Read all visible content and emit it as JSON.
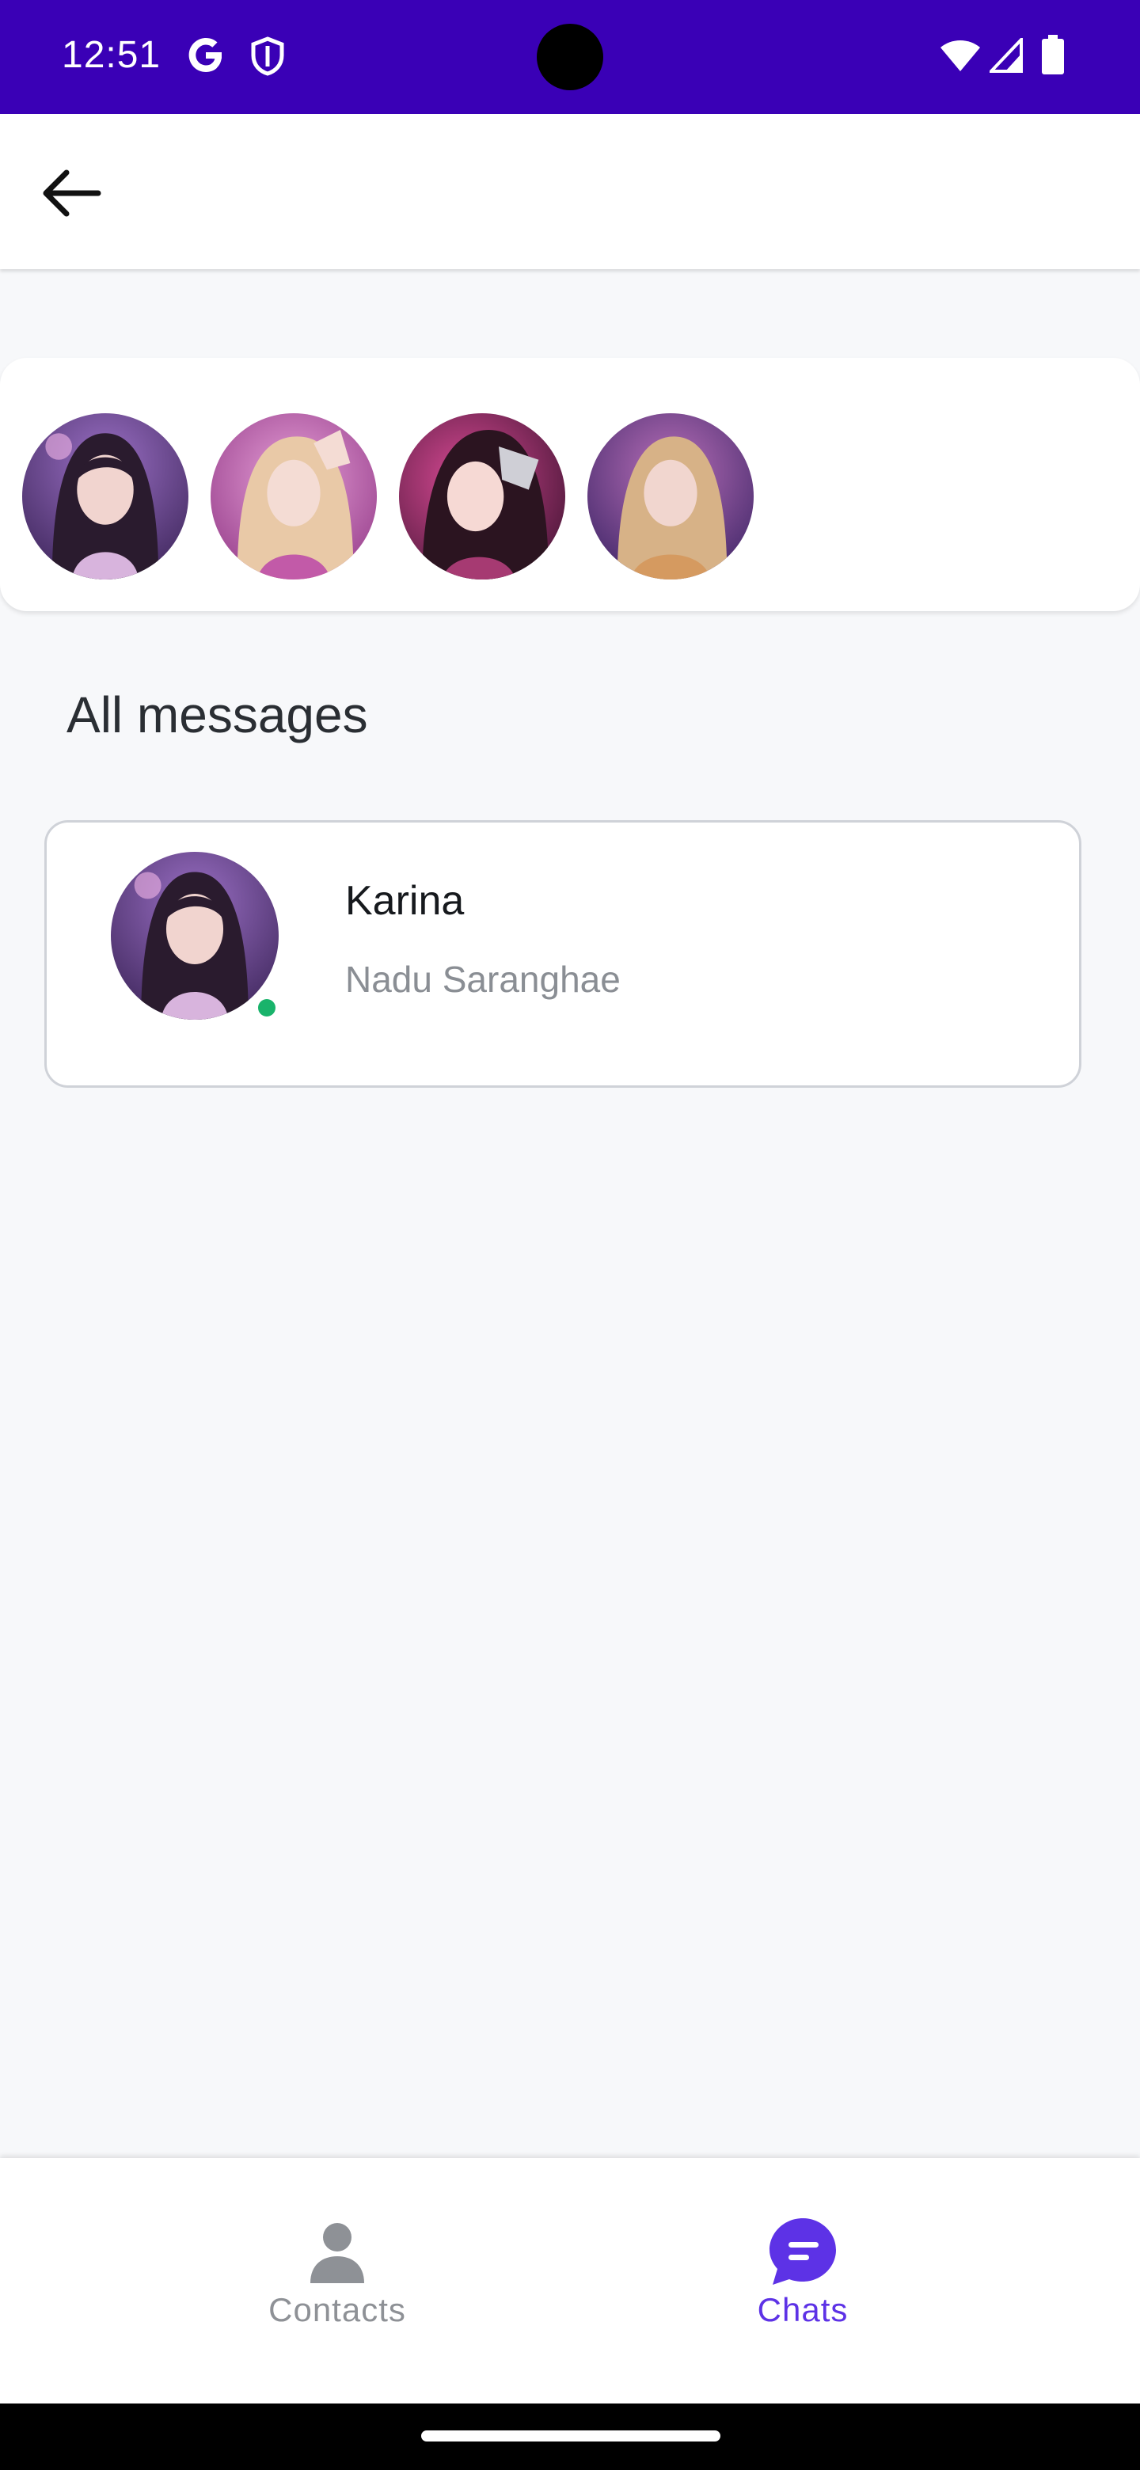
{
  "status_bar": {
    "time": "12:51",
    "icons": [
      "google-icon",
      "shield-icon",
      "wifi-icon",
      "signal-icon",
      "battery-icon"
    ],
    "background": "#3a00b6"
  },
  "top_bar": {
    "back_icon": "arrow-left-icon"
  },
  "stories": {
    "avatars": [
      {
        "icon": "profile-photo"
      },
      {
        "icon": "profile-photo"
      },
      {
        "icon": "profile-photo"
      },
      {
        "icon": "profile-photo"
      }
    ]
  },
  "messages": {
    "section_title": "All messages",
    "items": [
      {
        "name": "Karina",
        "preview": "Nadu Saranghae",
        "online": true
      }
    ]
  },
  "bottom_nav": {
    "items": [
      {
        "label": "Contacts",
        "icon": "person-icon",
        "active": false
      },
      {
        "label": "Chats",
        "icon": "chat-bubble-icon",
        "active": true
      }
    ]
  },
  "colors": {
    "accent": "#5d32e6",
    "status_bar": "#3a00b6",
    "online": "#19b36b",
    "background": "#f7f8fa"
  }
}
